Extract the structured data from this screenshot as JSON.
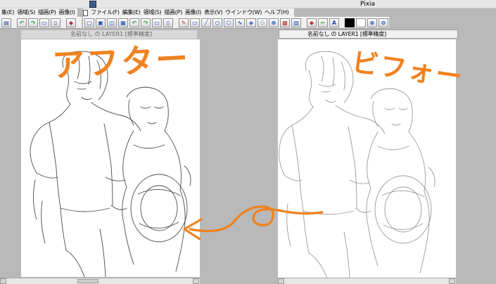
{
  "window": {
    "title": "Pixia"
  },
  "menu_left": {
    "items": [
      "集(E)",
      "領域(S)",
      "描画(P)",
      "画像(I)"
    ]
  },
  "menu_right": {
    "items": [
      "ファイル(F)",
      "編集(E)",
      "領域(S)",
      "描画(P)",
      "画像(I)",
      "表示(V)",
      "ウインドウ(W)",
      "ヘルプ(H)"
    ]
  },
  "canvas_window": {
    "title": "名前なし の LAYER1 [標準精度]"
  },
  "ghost_window": {
    "title": "名前なし の LAYER1 [標準精度]"
  },
  "annotations": {
    "after_label": "アフター",
    "before_label": "ビフォー"
  },
  "colors": {
    "annotation": "#f08220",
    "sketch_before": "#9a9a9a",
    "sketch_after": "#4a4a4a",
    "foreground": "#000000",
    "background": "#ffffff"
  },
  "icons": {
    "toolbar_left": [
      "open-icon",
      "undo-icon",
      "redo-icon",
      "copy-icon",
      "paste-icon"
    ],
    "toolbar_right": [
      "eraser-icon",
      "rect-select-icon",
      "frame-icon",
      "lasso-icon",
      "paint-icon",
      "line-icon",
      "circle-icon",
      "polygon-icon",
      "curve-icon",
      "brush-icon",
      "fill-icon",
      "spray-icon",
      "grid-icon",
      "color-picker-icon",
      "pen-icon",
      "text-icon",
      "zoom-in-icon",
      "zoom-out-icon"
    ]
  }
}
